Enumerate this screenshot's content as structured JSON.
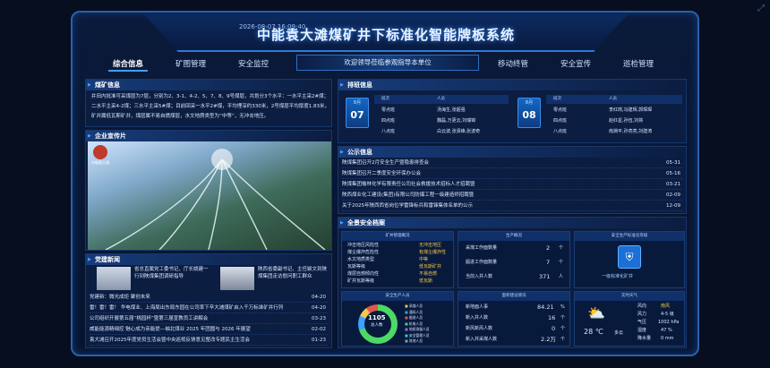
{
  "expand_icon": "⤢",
  "header": {
    "datetime": "2026-08-07 16:09:40",
    "title": "中能袁大滩煤矿井下标准化智能牌板系统",
    "sys_icons": "📶 🔔 ⏻"
  },
  "nav": {
    "left": [
      "综合信息",
      "矿图管理",
      "安全监控"
    ],
    "banner": "欢迎领导莅临参观指导本单位",
    "right": [
      "移动终管",
      "安全宣传",
      "巡检管理"
    ]
  },
  "mine_info": {
    "title": "煤矿信息",
    "text": "井田内批准可采煤层为7层，分别为2、3-1、4-2、5、7、8、9号煤层，共划分3个水平：一水平主采2#煤；二水平主采4-2煤；三水平主采5#煤；目前回采一水平2#煤，平均埋深约330米，2号煤层平均厚度1.83米，矿井属低瓦斯矿井，煤层属不易自燃煤层，水文地质类型为“中等”，无冲击地压。"
  },
  "enterprise": {
    "title": "企业宣传片",
    "logo": "中能袁大滩"
  },
  "party": {
    "title": "党建新闻",
    "news1": "省总直属党工委书记、厅长姚建一行到陕煤集团调研指导",
    "news2": "陕西省委副书记、主任颖文到陕煤集团走访慰问职工群众",
    "list": [
      {
        "t": "党建新：微光成炬 聚创未来",
        "d": "04-20"
      },
      {
        "t": "雷！雷！雷！ 华电煤业、上海局出东局东园在公司率下辛大滩煤矿启入千万标准矿并行列",
        "d": "04-20"
      },
      {
        "t": "公司组织开展第五届“桃园杯”暨第三届宣教员工讲解会",
        "d": "03-23"
      },
      {
        "t": "威能能源精细控 魅心成为亲能提—袖北煤业 2025 年团圆与 2026 年展望",
        "d": "02-02"
      },
      {
        "t": "袁大滩召开2025年度党员生活会暨中央巡视反馈意见整改专题民主生活会",
        "d": "01-23"
      }
    ]
  },
  "schedule": {
    "title": "排班信息",
    "left": {
      "month": "8月",
      "day": "07",
      "head": [
        "班次",
        "人员"
      ],
      "rows": [
        [
          "零点班",
          "汤海生,张超强"
        ],
        [
          "四点班",
          "魏磊,万更云,刘瑞锦"
        ],
        [
          "八点班",
          "白云波,张贤峰,张波奇"
        ]
      ]
    },
    "right": {
      "month": "8月",
      "day": "08",
      "head": [
        "班次",
        "人员"
      ],
      "rows": [
        [
          "零点班",
          "李红岗,冯建辉,郭琛琛"
        ],
        [
          "四点班",
          "赵红星,孙伍,刘将"
        ],
        [
          "八点班",
          "南淵平,孙亮亮,刘建涛"
        ]
      ]
    }
  },
  "notice": {
    "title": "公示信息",
    "rows": [
      {
        "t": "陕煤集团召开2月安全生产暨隐患排查会",
        "d": "05-31"
      },
      {
        "t": "陕煤集团召开二季度安全环保办公会",
        "d": "05-16"
      },
      {
        "t": "陕煤集团榆林化学有限责任公司社会救援技术招标人才招聘暨",
        "d": "03-21"
      },
      {
        "t": "陕西煤业化工建设(集团)有限公司防爆工程一级建造师招聘暨",
        "d": "02-09"
      },
      {
        "t": "关于2025年陕西西省岗位学雷锋标兵和雷锋集体名单的公示",
        "d": "12-09"
      }
    ]
  },
  "safety": {
    "title": "全景安全档案",
    "mine_status": {
      "title": "矿井管理概况",
      "rows": [
        [
          "冲击地压风险性",
          "无冲击地压"
        ],
        [
          "煤尘爆炸危险性",
          "有煤尘爆炸性"
        ],
        [
          "水文地质类型",
          "中等"
        ],
        [
          "瓦斯等级",
          "低瓦斯矿井"
        ],
        [
          "煤层自燃倾向性",
          "不易自燃"
        ],
        [
          "矿井瓦斯等级",
          "低瓦斯"
        ]
      ]
    },
    "production": {
      "title": "生产概况",
      "rows": [
        [
          "采煤工作面数量",
          "2",
          "个"
        ],
        [
          "掘进工作面数量",
          "7",
          "个"
        ],
        [
          "当前入井人数",
          "371",
          "人"
        ]
      ]
    },
    "standard": {
      "title": "安全生产标准化等级",
      "level": "一级标准化矿井"
    },
    "personnel": {
      "title": "安全生产人员",
      "total": "1105",
      "unit": "总人数",
      "legend": [
        "采煤人员",
        "通风人员",
        "掘进人员",
        "机电人员",
        "地质测量人员",
        "安全管理人员",
        "其他人员"
      ],
      "colors": [
        "#f2c94c",
        "#3ea0ff",
        "#e2574c",
        "#4cd964",
        "#a06bff",
        "#2ed1d1",
        "#8aa0c0"
      ]
    },
    "lease": {
      "title": "面积建设情况",
      "rows": [
        [
          "新地面人事",
          "84.21",
          "%"
        ],
        [
          "新入井人数",
          "16",
          "个"
        ],
        [
          "新风新风人数",
          "0",
          "个"
        ],
        [
          "新入井采煤人数",
          "2.2万",
          "个"
        ]
      ]
    },
    "weather": {
      "title": "实时天气",
      "temp": "28 ℃",
      "cond": "多云",
      "rows": [
        [
          "风向",
          "南风"
        ],
        [
          "风力",
          "4-5 级"
        ],
        [
          "气压",
          "1002 hPa"
        ],
        [
          "湿度",
          "47 %"
        ],
        [
          "降水量",
          "0 mm"
        ]
      ]
    }
  }
}
